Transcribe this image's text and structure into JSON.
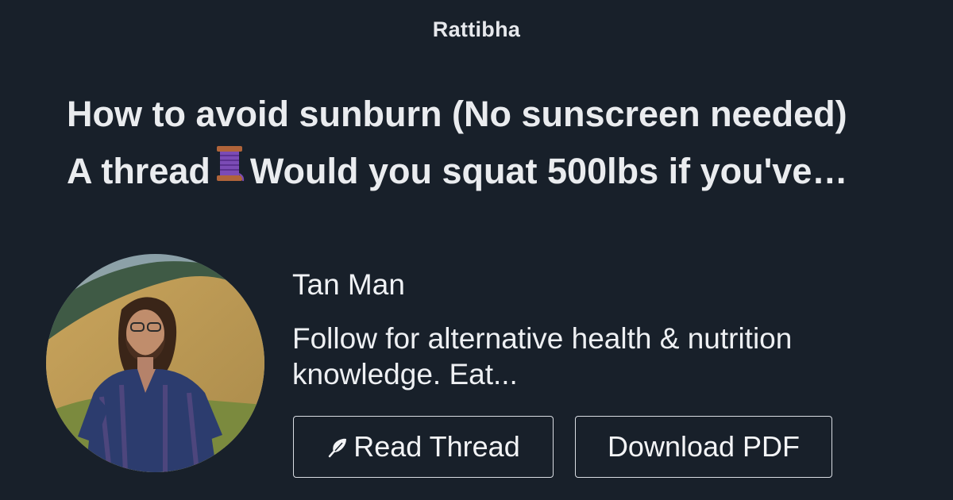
{
  "brand": "Rattibha",
  "thread": {
    "title_line1": "How to avoid sunburn (No sunscreen needed)",
    "title_line2_before": "A thread",
    "title_line2_after": "Would you squat 500lbs if you've…",
    "title_icon": "spool-of-thread-icon"
  },
  "author": {
    "name": "Tan Man",
    "bio_line1": "Follow for alternative health & nutrition",
    "bio_line2": "knowledge. Eat..."
  },
  "buttons": {
    "read_label": "Read Thread",
    "read_icon": "feather-icon",
    "pdf_label": "Download PDF"
  },
  "colors": {
    "background": "#18202a",
    "text": "#eef0f3",
    "button_border": "#d9dde3",
    "spool": "#7b4bb5"
  }
}
